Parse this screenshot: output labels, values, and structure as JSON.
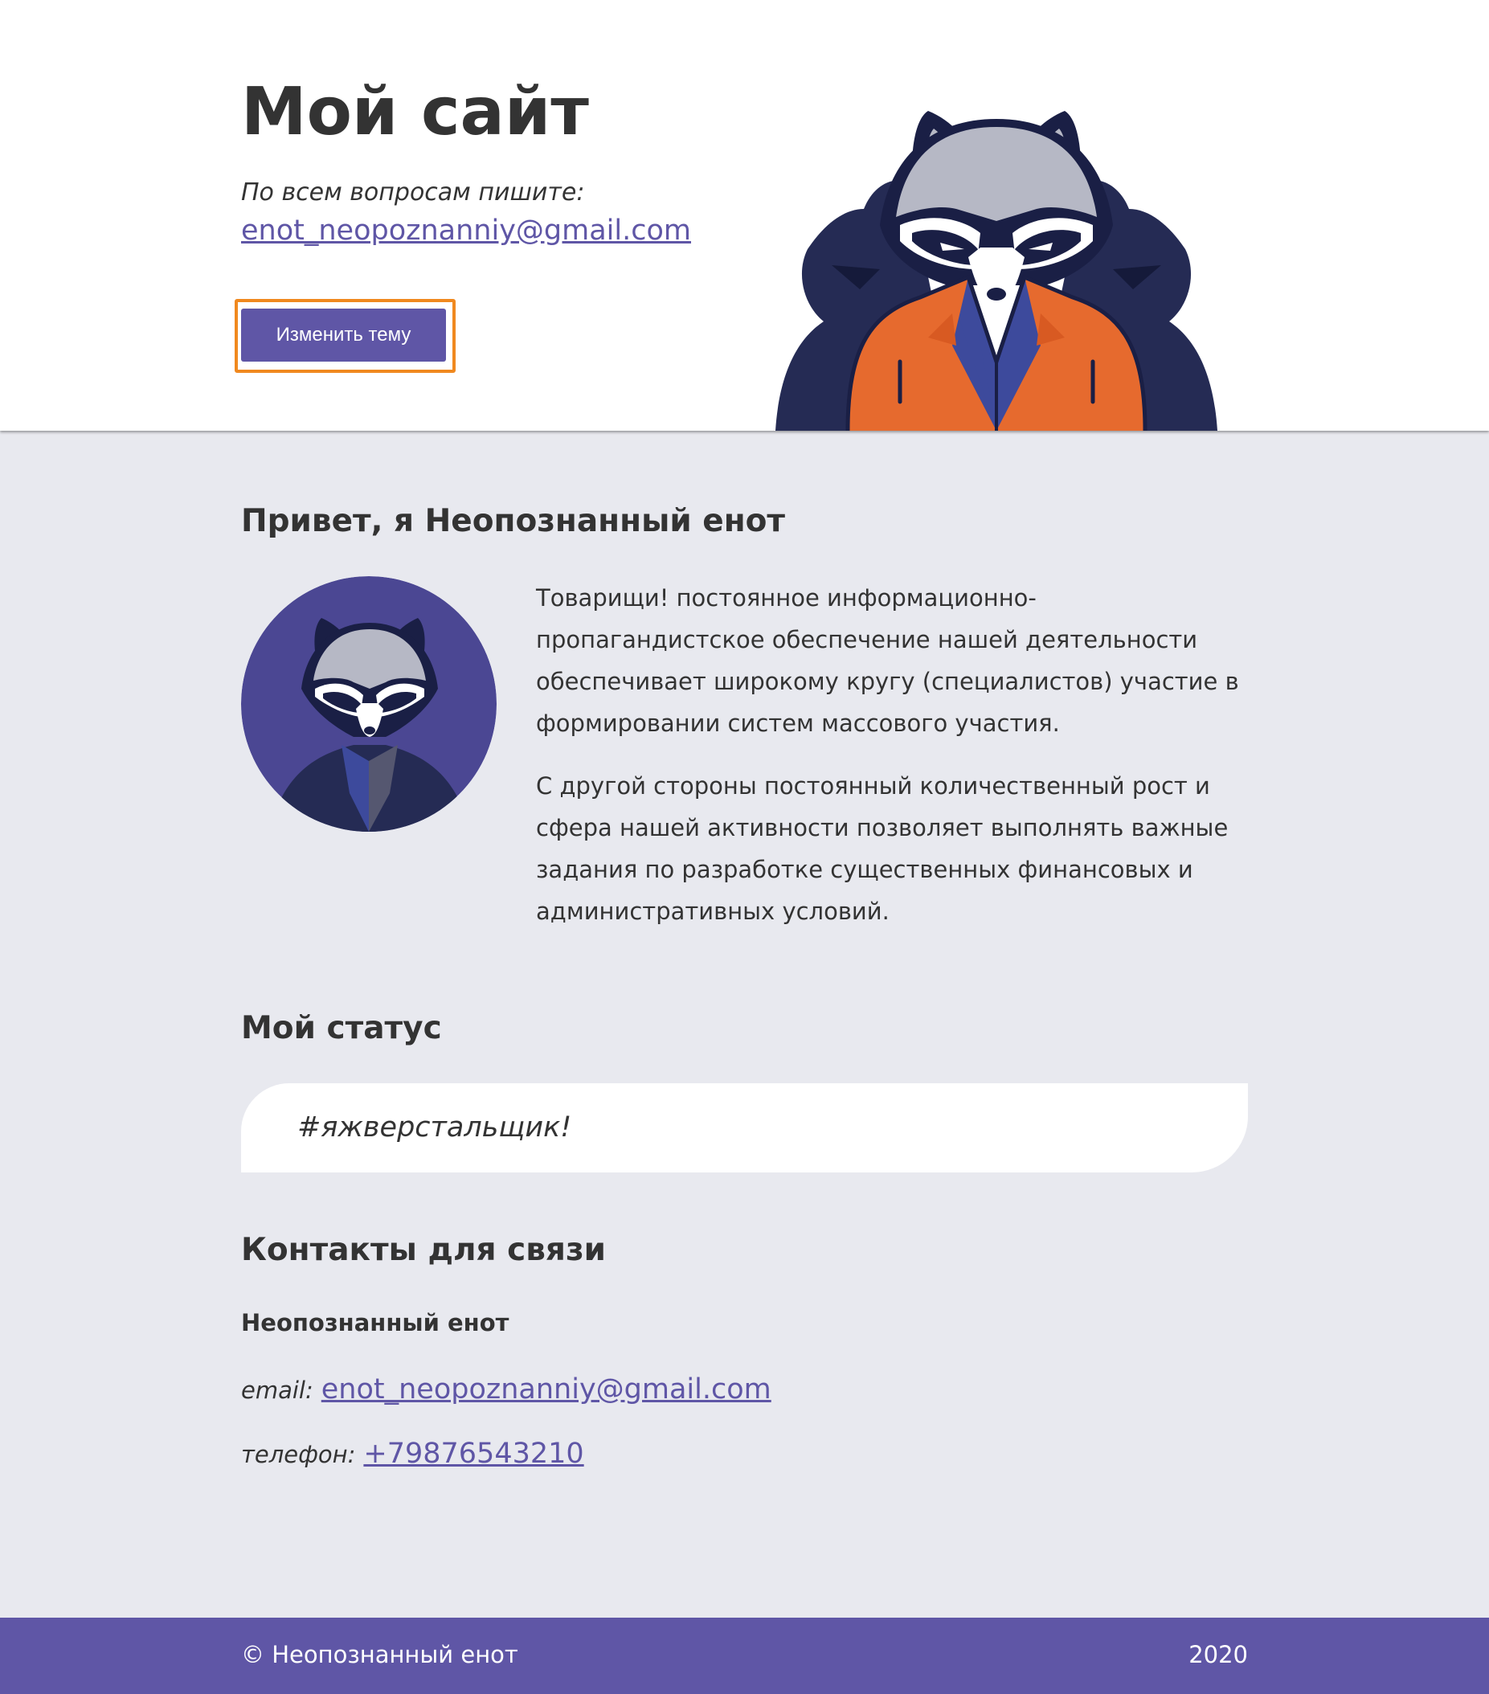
{
  "header": {
    "title": "Мой сайт",
    "contact_label": "По всем вопросам пишите:",
    "email": "enot_neopoznanniy@gmail.com",
    "theme_button_label": "Изменить тему",
    "hero_image": "raccoon-in-orange-jacket-illustration"
  },
  "about": {
    "title": "Привет, я Неопознанный енот",
    "avatar_image": "raccoon-avatar-illustration",
    "paragraphs": [
      "Товарищи! постоянное информационно-пропагандистское обеспечение нашей деятельности обеспечивает широкому кругу (специалистов) участие в формировании систем массового участия.",
      "С другой стороны постоянный количественный рост и сфера нашей активности позволяет выполнять важные задания по разработке существенных финансовых и административных условий."
    ]
  },
  "status": {
    "title": "Мой статус",
    "text": "#яжверстальщик!"
  },
  "contacts": {
    "title": "Контакты для связи",
    "name": "Неопознанный енот",
    "email_label": "email:",
    "email": "enot_neopoznanniy@gmail.com",
    "phone_label": "телефон:",
    "phone": "+79876543210"
  },
  "footer": {
    "copyright": "© Неопознанный енот",
    "year": "2020"
  },
  "colors": {
    "accent": "#5f56a6",
    "focus_outline": "#f0891f",
    "page_background": "#e8e9ef",
    "header_background": "#ffffff",
    "text": "#333333",
    "jacket_orange": "#e66a2e",
    "raccoon_navy": "#252b54"
  }
}
